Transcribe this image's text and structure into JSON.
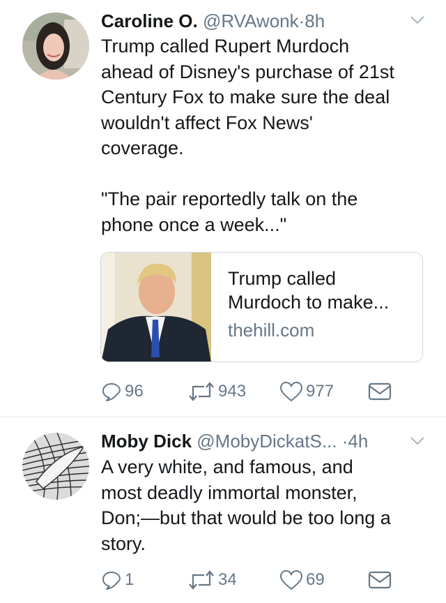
{
  "tweets": [
    {
      "name": "Caroline O.",
      "handle": "@RVAwonk",
      "separator": "·",
      "time": "8h",
      "text": "Trump called Rupert Murdoch\nahead of Disney's purchase of 21st\nCentury Fox to make sure the deal\nwouldn't affect Fox News'\ncoverage.\n\n\"The pair reportedly talk on the\nphone once a week...\"",
      "card": {
        "title": "Trump called\nMurdoch to make...",
        "domain": "thehill.com"
      },
      "replies": "96",
      "retweets": "943",
      "likes": "977"
    },
    {
      "name": "Moby Dick",
      "handle": "@MobyDickatS...",
      "separator": "·",
      "time": "4h",
      "text": "A very white, and famous, and\nmost deadly immortal monster,\nDon;—but that would be too long a\nstory.",
      "replies": "1",
      "retweets": "34",
      "likes": "69"
    }
  ],
  "icons": {
    "reply": "reply-icon",
    "retweet": "retweet-icon",
    "like": "heart-icon",
    "dm": "envelope-icon",
    "menu": "chevron-down-icon"
  },
  "colors": {
    "text": "#14171a",
    "secondary": "#657786",
    "border": "#e1e8ed"
  }
}
